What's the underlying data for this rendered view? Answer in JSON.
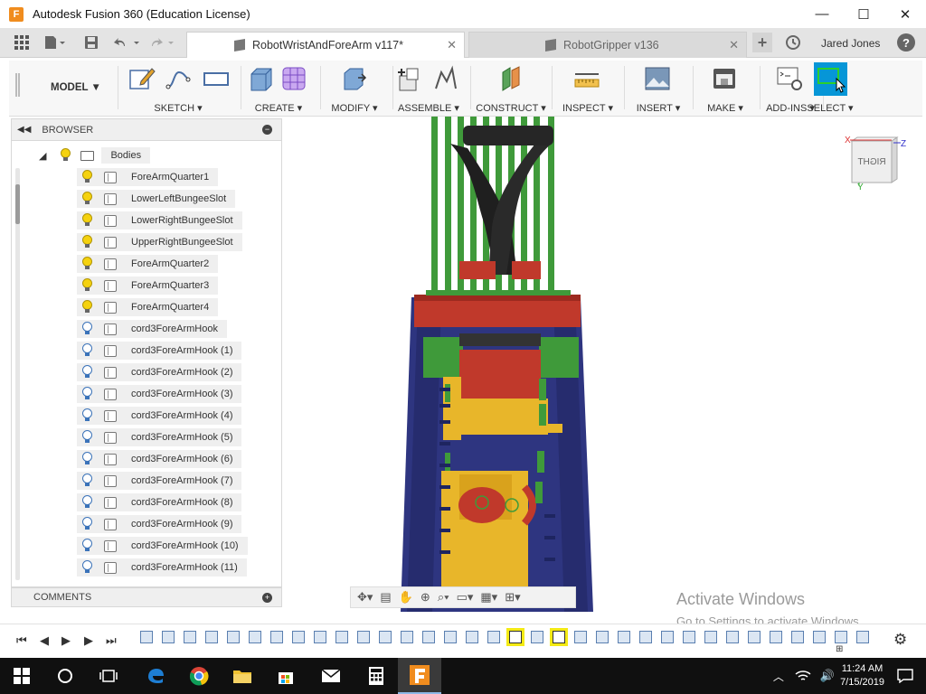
{
  "window": {
    "title": "Autodesk Fusion 360 (Education License)",
    "app_icon_letter": "F",
    "minimize": "—",
    "maximize": "☐",
    "close": "✕"
  },
  "tabs": [
    {
      "label": "RobotWristAndForeArm v117*",
      "active": true,
      "close": "✕"
    },
    {
      "label": "RobotGripper v136",
      "active": false,
      "close": "✕"
    }
  ],
  "tabbar": {
    "new_tab": "+",
    "user": "Jared Jones",
    "help": "?"
  },
  "toolbar": {
    "workspace": "MODEL ▼",
    "groups": [
      {
        "label": "SKETCH ▾"
      },
      {
        "label": "CREATE ▾"
      },
      {
        "label": "MODIFY ▾"
      },
      {
        "label": "ASSEMBLE ▾"
      },
      {
        "label": "CONSTRUCT ▾"
      },
      {
        "label": "INSPECT ▾"
      },
      {
        "label": "INSERT ▾"
      },
      {
        "label": "MAKE ▾"
      },
      {
        "label": "ADD-INS ▾"
      },
      {
        "label": "SELECT ▾"
      }
    ]
  },
  "browser": {
    "title": "BROWSER",
    "folder": "Bodies",
    "items": [
      {
        "label": "ForeArmQuarter1",
        "bulb": "on"
      },
      {
        "label": "LowerLeftBungeeSlot",
        "bulb": "on"
      },
      {
        "label": "LowerRightBungeeSlot",
        "bulb": "on"
      },
      {
        "label": "UpperRightBungeeSlot",
        "bulb": "on"
      },
      {
        "label": "ForeArmQuarter2",
        "bulb": "on"
      },
      {
        "label": "ForeArmQuarter3",
        "bulb": "on"
      },
      {
        "label": "ForeArmQuarter4",
        "bulb": "on"
      },
      {
        "label": "cord3ForeArmHook",
        "bulb": "off"
      },
      {
        "label": "cord3ForeArmHook (1)",
        "bulb": "off"
      },
      {
        "label": "cord3ForeArmHook (2)",
        "bulb": "off"
      },
      {
        "label": "cord3ForeArmHook (3)",
        "bulb": "off"
      },
      {
        "label": "cord3ForeArmHook (4)",
        "bulb": "off"
      },
      {
        "label": "cord3ForeArmHook (5)",
        "bulb": "off"
      },
      {
        "label": "cord3ForeArmHook (6)",
        "bulb": "off"
      },
      {
        "label": "cord3ForeArmHook (7)",
        "bulb": "off"
      },
      {
        "label": "cord3ForeArmHook (8)",
        "bulb": "off"
      },
      {
        "label": "cord3ForeArmHook (9)",
        "bulb": "off"
      },
      {
        "label": "cord3ForeArmHook (10)",
        "bulb": "off"
      },
      {
        "label": "cord3ForeArmHook (11)",
        "bulb": "off"
      }
    ]
  },
  "comments": {
    "title": "COMMENTS"
  },
  "viewcube": {
    "face": "RIGHT",
    "x_axis": "X",
    "y_axis": "Y",
    "z_axis": "Z"
  },
  "watermark": {
    "line1": "Activate Windows",
    "line2": "Go to Settings to activate Windows."
  },
  "taskbar": {
    "time": "11:24 AM",
    "date": "7/15/2019",
    "volume": "🔊"
  },
  "colors": {
    "accent": "#0696d7",
    "timeline_highlight": "#f4ea14",
    "model_navy": "#2e3580",
    "model_red": "#c0392b",
    "model_green": "#3f9a3a",
    "model_yellow": "#e8b62a",
    "model_black": "#1f1f1f"
  }
}
